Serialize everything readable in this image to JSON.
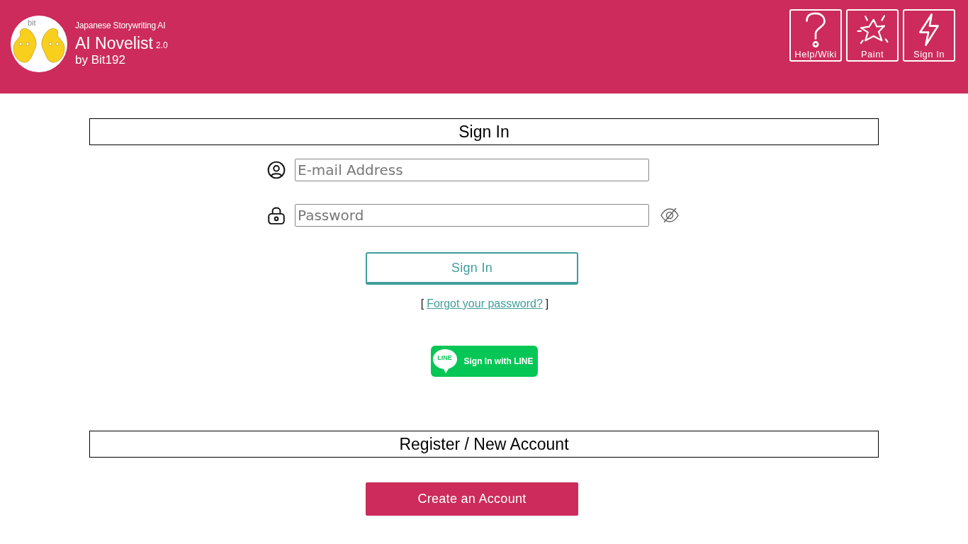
{
  "header": {
    "logo_text": "bit",
    "tagline": "Japanese Storywriting AI",
    "title": "AI Novelist",
    "version": "2.0",
    "byline": "by Bit192",
    "nav": [
      {
        "kind": "help",
        "label": "Help/Wiki"
      },
      {
        "kind": "paint",
        "label": "Paint"
      },
      {
        "kind": "signin",
        "label": "Sign In"
      }
    ]
  },
  "sign_in": {
    "heading": "Sign In",
    "fields": [
      {
        "kind": "email",
        "placeholder": "E-mail Address"
      },
      {
        "kind": "password",
        "placeholder": "Password"
      }
    ],
    "submit": "Sign In",
    "forgot": {
      "open": "[",
      "link": "Forgot your password?",
      "close": "]"
    },
    "line_button": {
      "badge": "LINE",
      "label": "Sign In with LINE"
    }
  },
  "register": {
    "heading": "Register / New Account",
    "button": "Create an Account"
  }
}
